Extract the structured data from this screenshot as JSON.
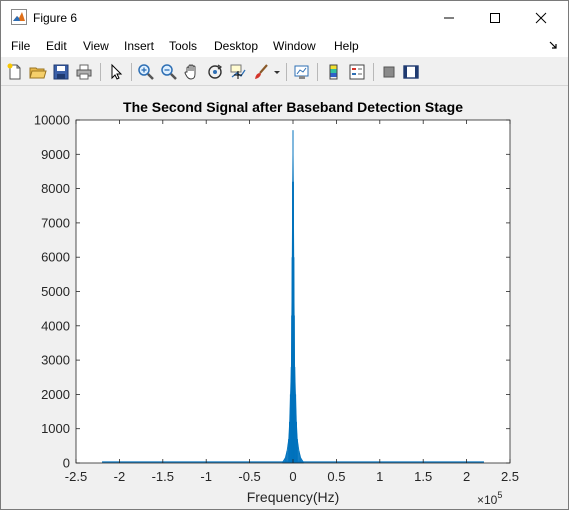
{
  "window": {
    "title": "Figure 6"
  },
  "icons": {
    "app": "matlab-logo-icon",
    "minimize": "minimize-icon",
    "maximize": "maximize-icon",
    "close": "close-icon"
  },
  "menu": {
    "items": [
      "File",
      "Edit",
      "View",
      "Insert",
      "Tools",
      "Desktop",
      "Window",
      "Help"
    ]
  },
  "toolbar": {
    "buttons": [
      "new-figure-icon",
      "open-file-icon",
      "save-icon",
      "print-icon",
      "pointer-icon",
      "zoom-in-icon",
      "zoom-out-icon",
      "pan-hand-icon",
      "rotate-3d-icon",
      "data-cursor-icon",
      "brush-icon",
      "link-plot-icon",
      "colorbar-icon",
      "legend-icon",
      "hide-plot-tools-icon",
      "show-plot-tools-icon"
    ]
  },
  "colors": {
    "line": "#0072bd",
    "plot_bg": "#ffffff",
    "figure_bg": "#f0f0f0"
  },
  "chart_data": {
    "type": "line",
    "title": "The Second Signal after Baseband Detection Stage",
    "xlabel": "Frequency(Hz)",
    "ylabel": "",
    "x_exponent": "×10",
    "x_exponent_power": "5",
    "xlim": [
      -2.5,
      2.5
    ],
    "ylim": [
      0,
      10000
    ],
    "x_ticks": [
      -2.5,
      -2,
      -1.5,
      -1,
      -0.5,
      0,
      0.5,
      1,
      1.5,
      2,
      2.5
    ],
    "x_tick_labels": [
      "-2.5",
      "-2",
      "-1.5",
      "-1",
      "-0.5",
      "0",
      "0.5",
      "1",
      "1.5",
      "2",
      "2.5"
    ],
    "y_ticks": [
      0,
      1000,
      2000,
      3000,
      4000,
      5000,
      6000,
      7000,
      8000,
      9000,
      10000
    ],
    "y_tick_labels": [
      "0",
      "1000",
      "2000",
      "3000",
      "4000",
      "5000",
      "6000",
      "7000",
      "8000",
      "9000",
      "10000"
    ],
    "grid": false,
    "data_extent_x": [
      -2.2,
      2.2
    ],
    "series": [
      {
        "x": [
          -0.12,
          -0.09,
          -0.07,
          -0.05,
          -0.04,
          -0.03,
          -0.02,
          -0.015,
          -0.01,
          -0.005,
          0,
          0.005,
          0.01,
          0.015,
          0.02,
          0.03,
          0.04,
          0.05,
          0.07,
          0.09,
          0.12
        ],
        "y": [
          30,
          150,
          350,
          700,
          1200,
          2000,
          2800,
          4300,
          6000,
          8200,
          9700,
          8200,
          6000,
          4300,
          2800,
          2000,
          1200,
          700,
          350,
          150,
          30
        ]
      }
    ]
  }
}
